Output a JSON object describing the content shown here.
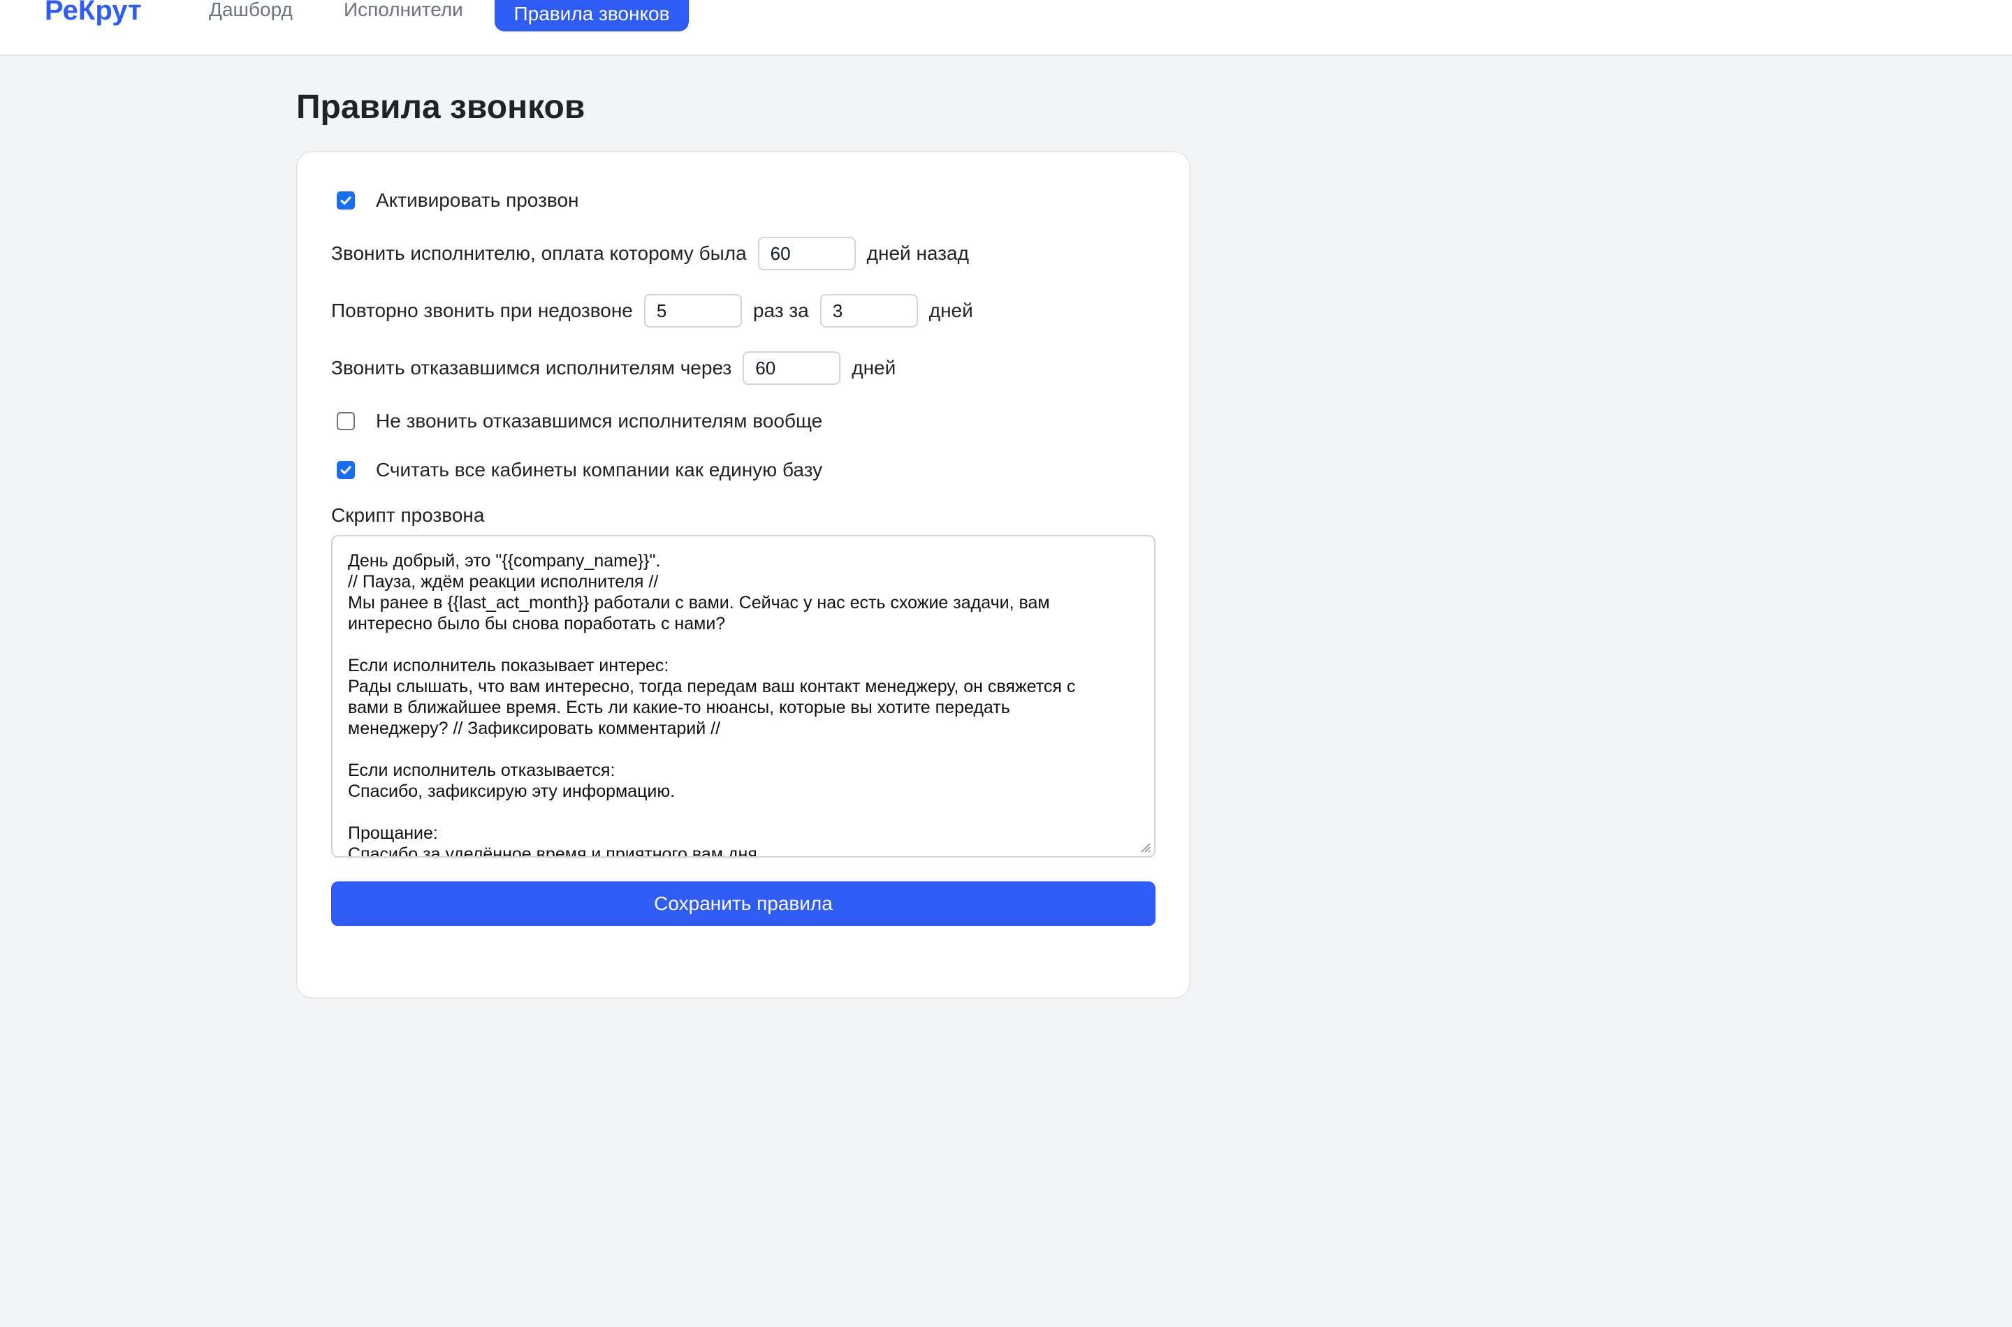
{
  "header": {
    "logo": "РеКрут",
    "nav": [
      "Дашборд",
      "Исполнители",
      "Правила звонков"
    ],
    "active_index": 2
  },
  "page_title": "Правила звонков",
  "form": {
    "activate_calls": {
      "label": "Активировать прозвон",
      "checked": true
    },
    "paid_ago": {
      "before": "Звонить исполнителю, оплата которому была",
      "value": "60",
      "after": "дней назад"
    },
    "retry": {
      "before": "Повторно звонить при недозвоне",
      "times_value": "5",
      "middle": "раз за",
      "days_value": "3",
      "after": "дней"
    },
    "refused_after": {
      "before": "Звонить отказавшимся исполнителям через",
      "value": "60",
      "after": "дней"
    },
    "never_call_refused": {
      "label": "Не звонить отказавшимся исполнителям вообще",
      "checked": false
    },
    "single_base": {
      "label": "Считать все кабинеты компании как единую базу",
      "checked": true
    },
    "script_label": "Скрипт прозвона",
    "script_lines": [
      "День добрый, это \"{{company_name}}\".",
      "// Пауза, ждём реакции исполнителя //",
      "Мы ранее в {{last_act_month}} работали с вами. Сейчас у нас есть схожие задачи, вам",
      "интересно было бы снова поработать с нами?",
      "",
      "Если исполнитель показывает интерес:",
      "Рады слышать, что вам интересно, тогда передам ваш контакт менеджеру, он свяжется с",
      "вами в ближайшее время. Есть ли какие-то нюансы, которые вы хотите передать",
      "менеджеру? // Зафиксировать комментарий //",
      "",
      "Если исполнитель отказывается:",
      "Спасибо, зафиксирую эту информацию.",
      "",
      "Прощание:",
      "Спасибо за уделённое время и приятного вам дня."
    ],
    "save_label": "Сохранить правила"
  }
}
